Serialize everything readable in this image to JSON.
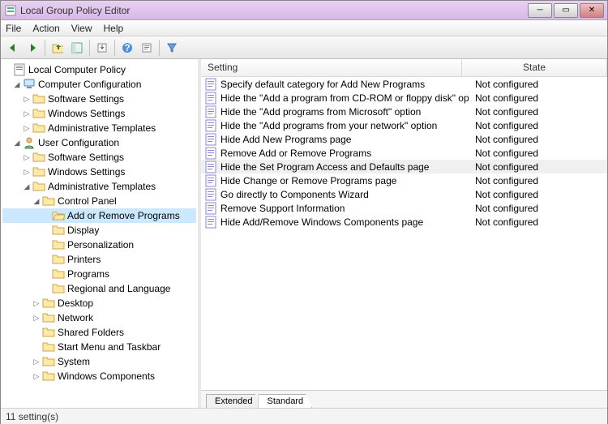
{
  "window": {
    "title": "Local Group Policy Editor"
  },
  "menu": {
    "file": "File",
    "action": "Action",
    "view": "View",
    "help": "Help"
  },
  "tree": {
    "root": "Local Computer Policy",
    "cc": "Computer Configuration",
    "cc_sw": "Software Settings",
    "cc_win": "Windows Settings",
    "cc_at": "Administrative Templates",
    "uc": "User Configuration",
    "uc_sw": "Software Settings",
    "uc_win": "Windows Settings",
    "uc_at": "Administrative Templates",
    "cp": "Control Panel",
    "cp_arp": "Add or Remove Programs",
    "cp_display": "Display",
    "cp_personalization": "Personalization",
    "cp_printers": "Printers",
    "cp_programs": "Programs",
    "cp_regional": "Regional and Language",
    "desktop": "Desktop",
    "network": "Network",
    "shared": "Shared Folders",
    "startmenu": "Start Menu and Taskbar",
    "system": "System",
    "wincomp": "Windows Components"
  },
  "list": {
    "headers": {
      "setting": "Setting",
      "state": "State"
    },
    "rows": [
      {
        "setting": "Specify default category for Add New Programs",
        "state": "Not configured"
      },
      {
        "setting": "Hide the \"Add a program from CD-ROM or floppy disk\" opti...",
        "state": "Not configured"
      },
      {
        "setting": "Hide the \"Add programs from Microsoft\" option",
        "state": "Not configured"
      },
      {
        "setting": "Hide the \"Add programs from your network\" option",
        "state": "Not configured"
      },
      {
        "setting": "Hide Add New Programs page",
        "state": "Not configured"
      },
      {
        "setting": "Remove Add or Remove Programs",
        "state": "Not configured"
      },
      {
        "setting": "Hide the Set Program Access and Defaults page",
        "state": "Not configured"
      },
      {
        "setting": "Hide Change or Remove Programs page",
        "state": "Not configured"
      },
      {
        "setting": "Go directly to Components Wizard",
        "state": "Not configured"
      },
      {
        "setting": "Remove Support Information",
        "state": "Not configured"
      },
      {
        "setting": "Hide Add/Remove Windows Components page",
        "state": "Not configured"
      }
    ],
    "selected_index": 6
  },
  "tabs": {
    "extended": "Extended",
    "standard": "Standard"
  },
  "status": {
    "text": "11 setting(s)"
  }
}
